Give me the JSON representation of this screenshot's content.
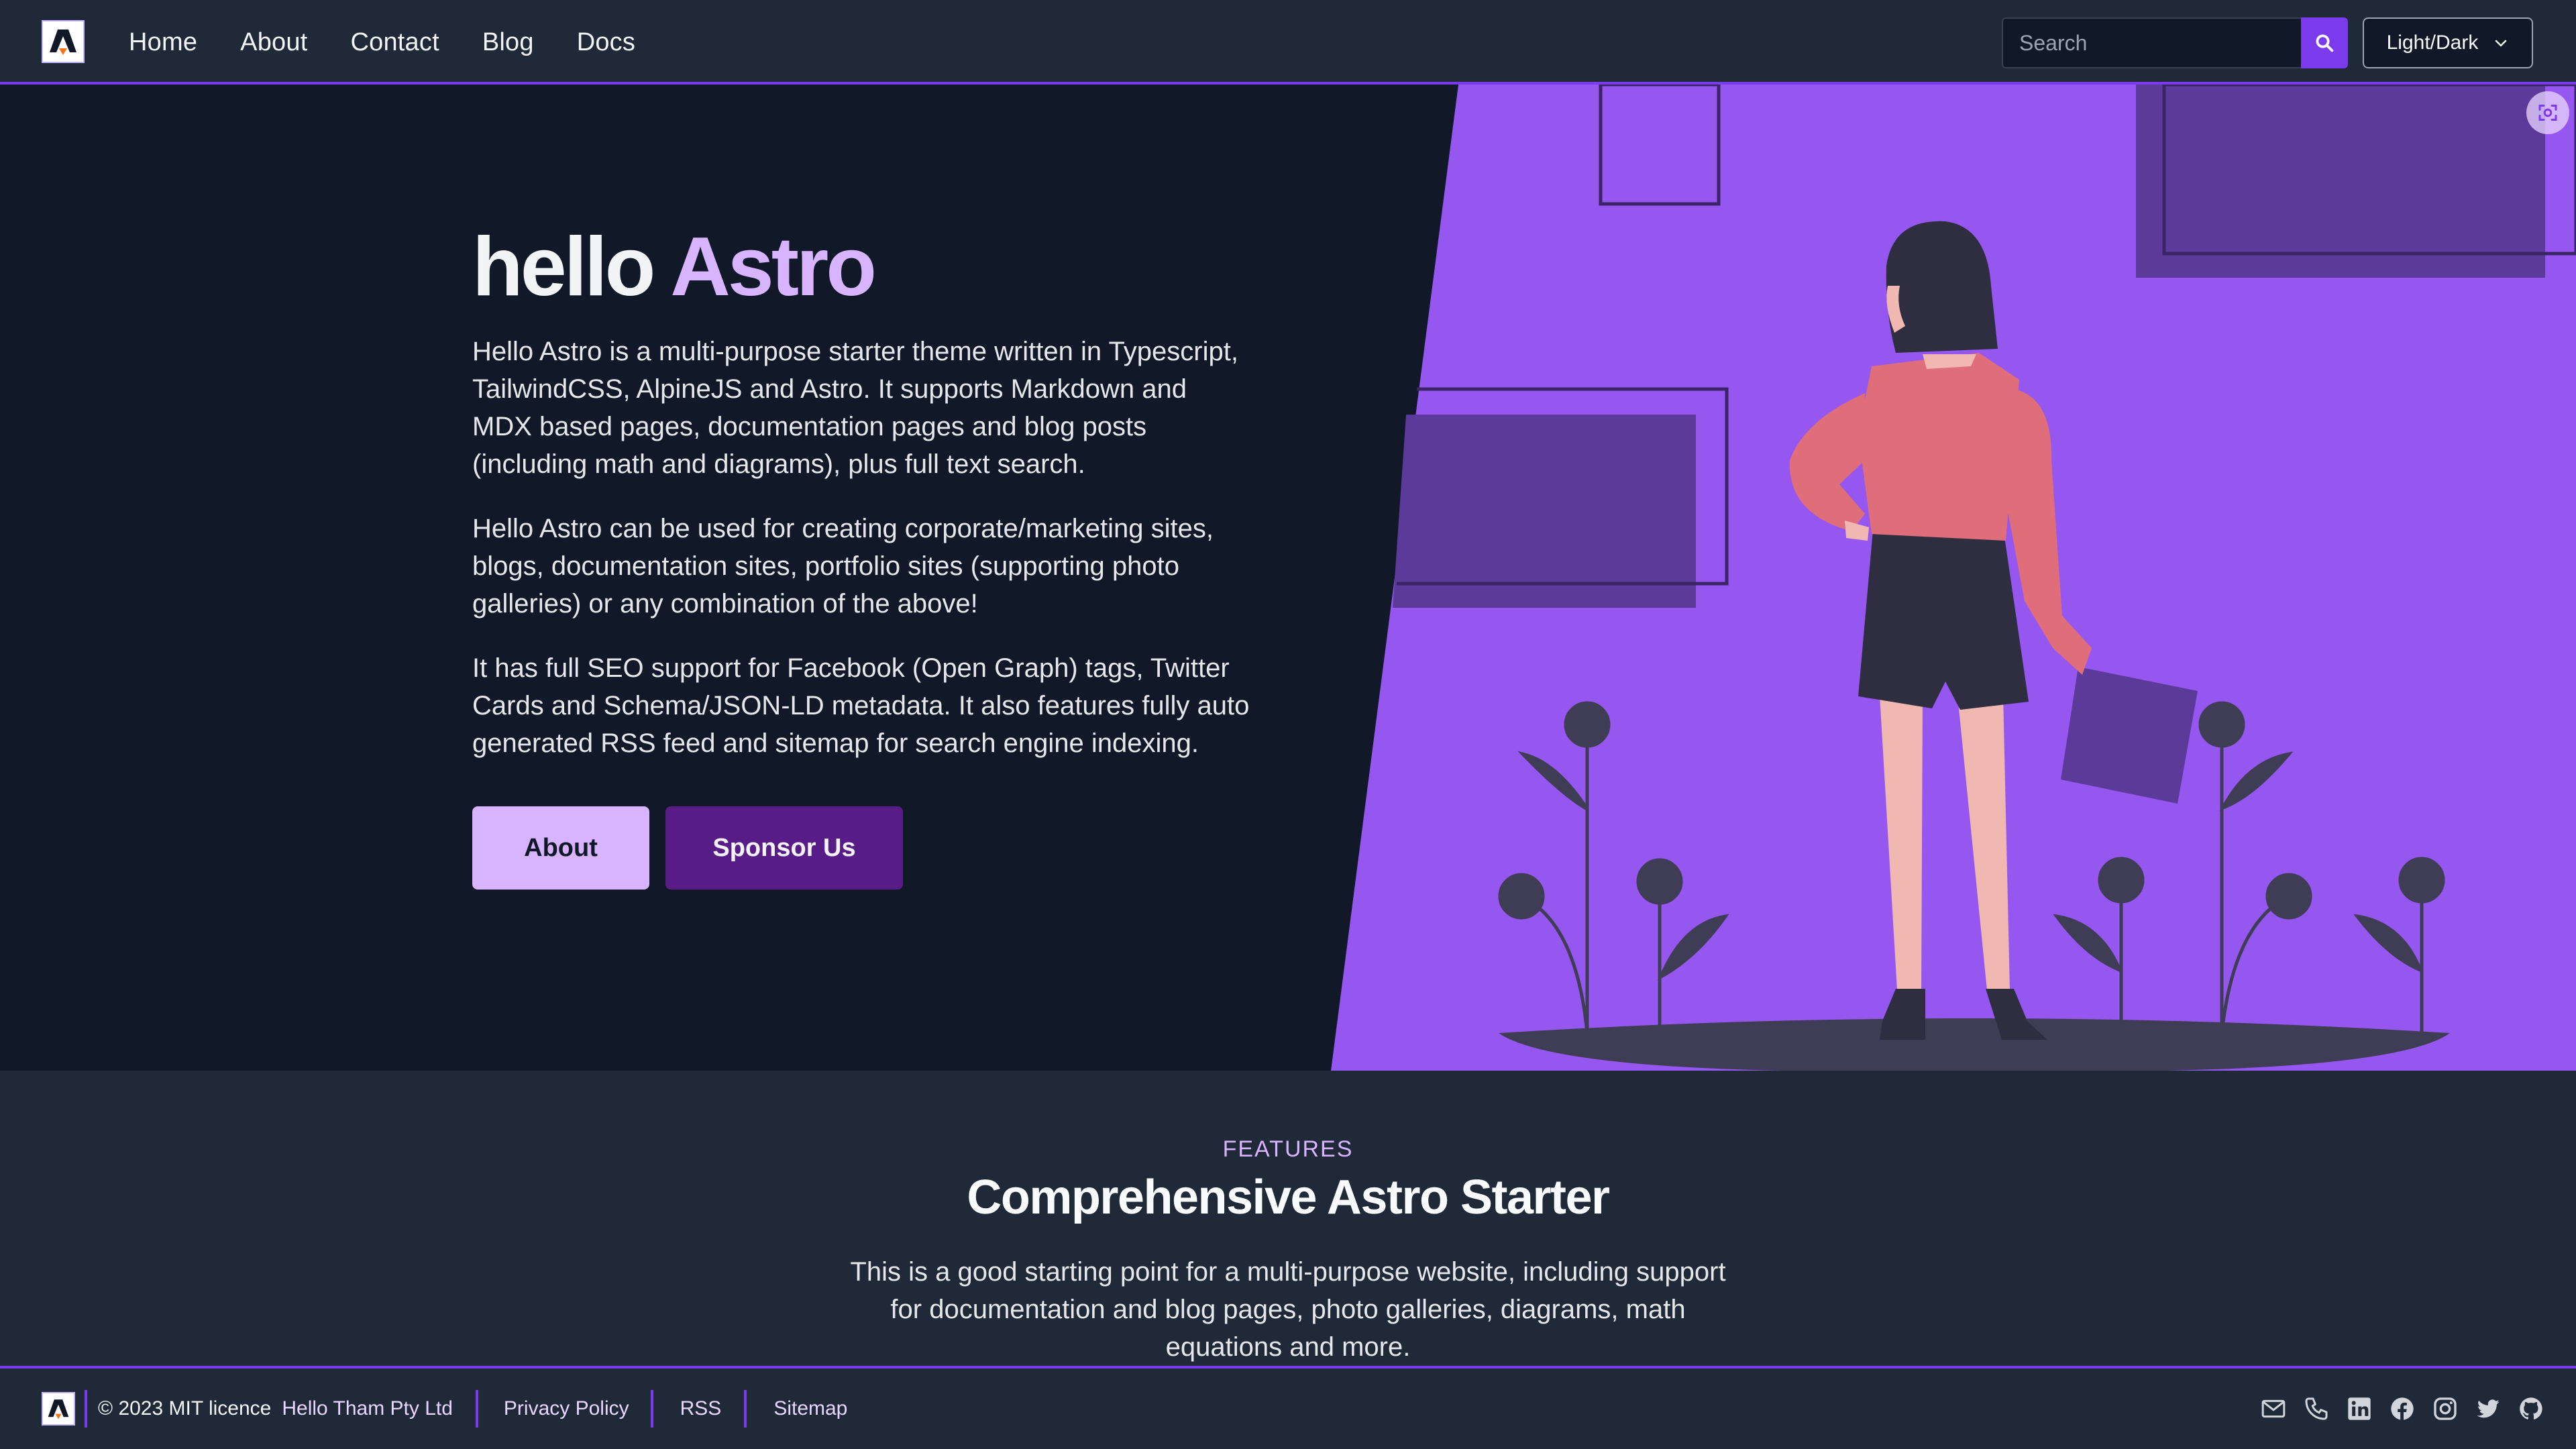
{
  "header": {
    "logo_alt": "Hello Astro logo",
    "nav": [
      "Home",
      "About",
      "Contact",
      "Blog",
      "Docs"
    ],
    "search": {
      "placeholder": "Search"
    },
    "theme_toggle_label": "Light/Dark"
  },
  "hero": {
    "title_prefix": "hello",
    "title_accent": "Astro",
    "paragraphs": [
      "Hello Astro is a multi-purpose starter theme written in Typescript, TailwindCSS, AlpineJS and Astro. It supports Markdown and MDX based pages, documentation pages and blog posts (including math and diagrams), plus full text search.",
      "Hello Astro can be used for creating corporate/marketing sites, blogs, documentation sites, portfolio sites (supporting photo galleries) or any combination of the above!",
      "It has full SEO support for Facebook (Open Graph) tags, Twitter Cards and Schema/JSON-LD metadata. It also features fully auto generated RSS feed and sitemap for search engine indexing."
    ],
    "buttons": {
      "primary": "About",
      "secondary": "Sponsor Us"
    }
  },
  "features": {
    "eyebrow": "FEATURES",
    "title": "Comprehensive Astro Starter",
    "description": "This is a good starting point for a multi-purpose website, including support for documentation and blog pages, photo galleries, diagrams, math equations and more."
  },
  "footer": {
    "copyright": "© 2023 MIT licence",
    "company": "Hello Tham Pty Ltd",
    "links": [
      "Privacy Policy",
      "RSS",
      "Sitemap"
    ],
    "social_icons": [
      "mail-icon",
      "phone-icon",
      "linkedin-icon",
      "facebook-icon",
      "instagram-icon",
      "twitter-icon",
      "github-icon"
    ]
  },
  "colors": {
    "accent": "#7c3aed",
    "accent_light": "#d8b4fe",
    "hero_bg": "#111827",
    "surface": "#1f2937",
    "illustration_bg": "#9657f0"
  }
}
